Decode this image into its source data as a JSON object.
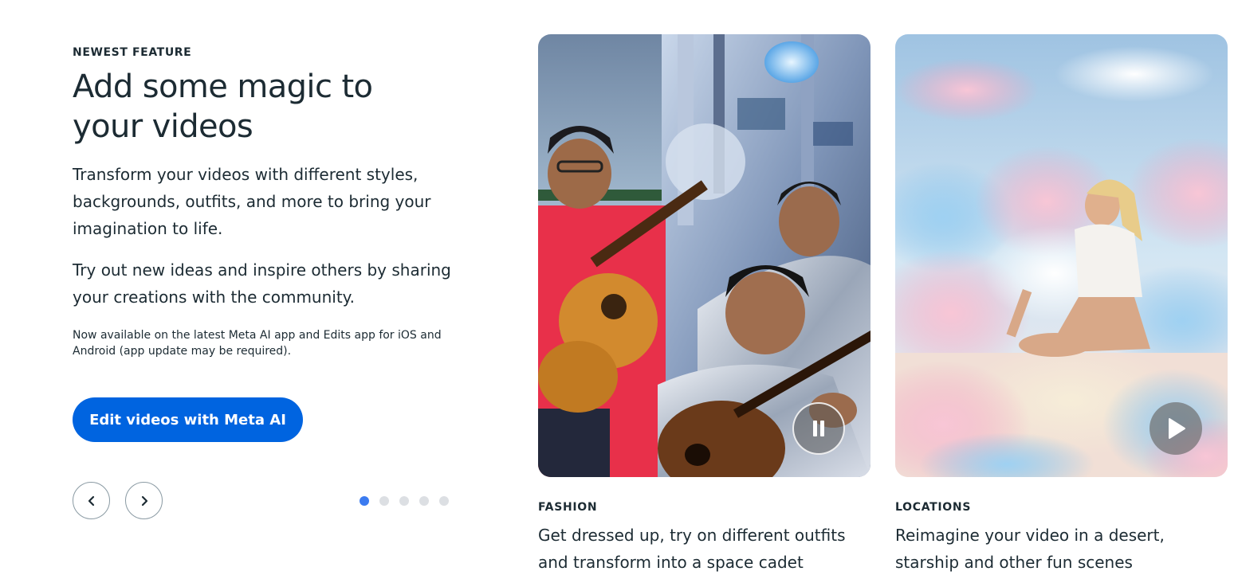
{
  "intro": {
    "eyebrow": "NEWEST FEATURE",
    "headline_line1": "Add some magic to",
    "headline_line2": "your videos",
    "paragraph1": "Transform your videos with different styles, backgrounds, outfits, and more to bring your imagination to life.",
    "paragraph2": "Try out new ideas and inspire others by sharing your creations with the community.",
    "fine_print": "Now available on the latest Meta AI app and Edits app for iOS and Android (app update may be required).",
    "cta_label": "Edit videos with Meta AI"
  },
  "carousel": {
    "prev_icon": "chevron-left-icon",
    "next_icon": "chevron-right-icon",
    "dot_count": 5,
    "active_dot": 1
  },
  "cards": [
    {
      "label": "FASHION",
      "description": "Get dressed up, try on different outfits and transform into a space cadet",
      "media_state": "playing",
      "control_icon": "pause-icon"
    },
    {
      "label": "LOCATIONS",
      "description": "Reimagine your video in a desert, starship and other fun scenes",
      "media_state": "paused",
      "control_icon": "play-icon"
    }
  ],
  "colors": {
    "accent": "#0064e0",
    "text": "#1c2b33",
    "dot_active": "#3b7bf0",
    "dot_inactive": "#dcdfe3"
  }
}
